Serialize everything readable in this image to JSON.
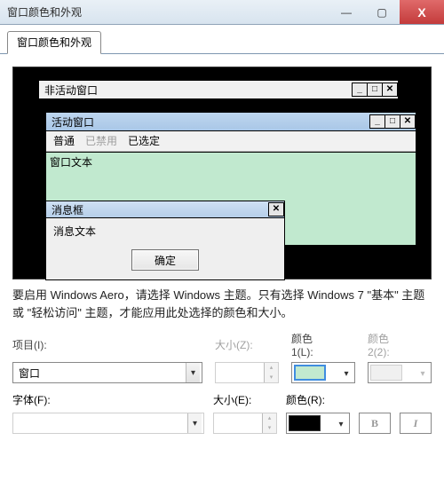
{
  "window": {
    "title": "窗口颜色和外观",
    "controls": {
      "min": "—",
      "max": "▢",
      "close": "X"
    }
  },
  "tab": {
    "label": "窗口颜色和外观"
  },
  "preview": {
    "inactive_title": "非活动窗口",
    "active_title": "活动窗口",
    "menu": {
      "normal": "普通",
      "disabled": "已禁用",
      "selected": "已选定"
    },
    "window_text": "窗口文本",
    "msgbox_title": "消息框",
    "msgbox_text": "消息文本",
    "ok": "确定",
    "win_ctrl": {
      "min": "_",
      "max": "□",
      "close": "✕"
    }
  },
  "note": "要启用 Windows Aero，请选择 Windows 主题。只有选择 Windows 7 \"基本\" 主题或 \"轻松访问\" 主题，才能应用此处选择的颜色和大小。",
  "labels": {
    "item": "项目(I):",
    "size": "大小(Z):",
    "color1": "颜色\n1(L):",
    "color2": "颜色\n2(2):",
    "font": "字体(F):",
    "size_e": "大小(E):",
    "color_r": "颜色(R):"
  },
  "values": {
    "item": "窗口",
    "size": "",
    "font": "",
    "size_e": "",
    "color1_hex": "#c1e9cf",
    "color_r_hex": "#000000",
    "bold": "B",
    "italic": "I"
  }
}
